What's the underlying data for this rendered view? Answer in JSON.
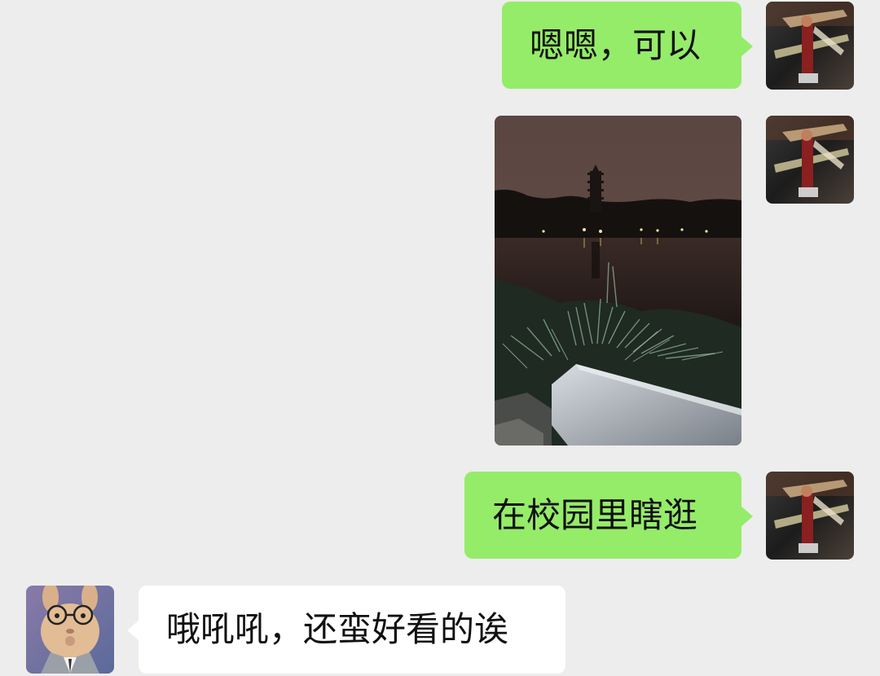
{
  "messages": [
    {
      "side": "out",
      "type": "text",
      "text": "嗯嗯，可以",
      "avatar": "self-avatar-figure"
    },
    {
      "side": "out",
      "type": "image",
      "subject": "night-lake-pagoda-photo",
      "avatar": "self-avatar-figure"
    },
    {
      "side": "out",
      "type": "text",
      "text": "在校园里瞎逛",
      "avatar": "self-avatar-figure"
    },
    {
      "side": "in",
      "type": "text",
      "text": "哦吼吼，还蛮好看的诶",
      "avatar": "rabbit-with-glasses-avatar"
    }
  ],
  "colors": {
    "background": "#ededed",
    "outgoing_bubble": "#95ec69",
    "incoming_bubble": "#ffffff",
    "text": "#111111"
  }
}
